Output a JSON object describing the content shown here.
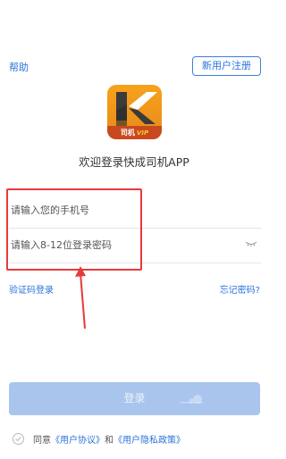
{
  "header": {
    "help_label": "帮助",
    "register_label": "新用户注册"
  },
  "logo": {
    "band_text": "司机",
    "vip_text": "VIP"
  },
  "welcome_text": "欢迎登录快成司机APP",
  "form": {
    "phone_placeholder": "请输入您的手机号",
    "password_placeholder": "请输入8-12位登录密码",
    "sms_login_label": "验证码登录",
    "forgot_password_label": "忘记密码?",
    "login_button_label": "登录"
  },
  "agreement": {
    "prefix": "同意",
    "user_agreement": "《用户协议》",
    "and": "和",
    "privacy_policy": "《用户隐私政策》"
  },
  "colors": {
    "accent": "#2b73d9",
    "annotation": "#e83a3a",
    "login_disabled": "#a9c5ee",
    "logo_orange": "#f7a21c",
    "logo_band": "#c9491f"
  }
}
